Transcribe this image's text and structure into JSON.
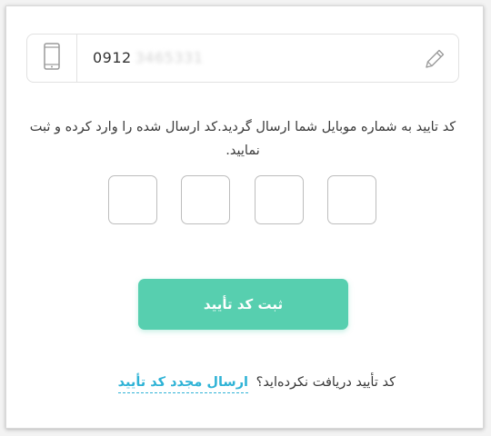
{
  "phone": {
    "value_visible": "0912",
    "value_masked": "3465331",
    "phone_icon": "mobile-phone-icon",
    "edit_icon": "pencil-icon"
  },
  "message": "کد تایید به شماره موبایل شما ارسال گردید.کد ارسال شده را وارد کرده و ثبت نمایید.",
  "code": {
    "digits": [
      "",
      "",
      "",
      ""
    ]
  },
  "submit": {
    "label": "ثبت کد تأیید",
    "color": "#57cfaf"
  },
  "resend": {
    "prompt": "کد تأیید دریافت نکرده‌اید؟",
    "link_label": "ارسال مجدد کد تأیید",
    "link_color": "#2fb3d6"
  }
}
